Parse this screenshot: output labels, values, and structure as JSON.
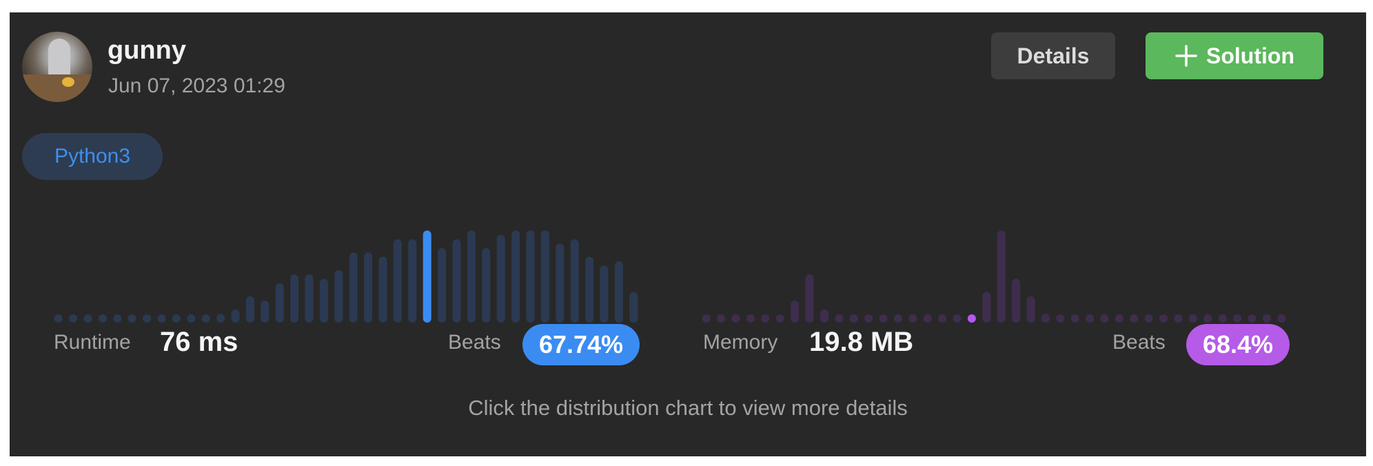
{
  "submission": {
    "username": "gunny",
    "timestamp": "Jun 07, 2023 01:29",
    "language": "Python3"
  },
  "actions": {
    "details_label": "Details",
    "solution_label": "Solution"
  },
  "runtime": {
    "label": "Runtime",
    "value": "76 ms",
    "beats_label": "Beats",
    "beats_value": "67.74%"
  },
  "memory": {
    "label": "Memory",
    "value": "19.8 MB",
    "beats_label": "Beats",
    "beats_value": "68.4%"
  },
  "hint": "Click the distribution chart to view more details",
  "colors": {
    "background": "#282828",
    "runtime_bar": "#2b3a52",
    "runtime_highlight": "#3a8cf2",
    "memory_bar": "#3f2d4e",
    "memory_highlight": "#b658f0",
    "runtime_pill": "#3a8cf2",
    "memory_pill": "#b65ae8",
    "solution_button": "#5cb85c",
    "details_button": "#3d3d3d"
  },
  "chart_data": [
    {
      "type": "bar",
      "name": "runtime-distribution",
      "values": [
        0.5,
        0.5,
        0.5,
        0.5,
        0.5,
        0.5,
        0.5,
        0.5,
        0.5,
        0.5,
        0.5,
        1,
        1.5,
        3,
        2.5,
        4.5,
        5.5,
        5.5,
        5,
        6,
        8,
        8,
        7.5,
        9.5,
        9.5,
        10.5,
        8.5,
        9.5,
        10.5,
        8.5,
        10,
        10.5,
        10.5,
        10.5,
        9,
        9.5,
        7.5,
        6.5,
        7,
        3.5
      ],
      "highlight_index": 25,
      "ylim": [
        0,
        11
      ]
    },
    {
      "type": "bar",
      "name": "memory-distribution",
      "values": [
        0.5,
        0.5,
        0.5,
        0.5,
        0.5,
        0.5,
        2.5,
        5.5,
        1.5,
        0.5,
        0.5,
        0.5,
        0.5,
        0.5,
        0.5,
        0.5,
        0.5,
        0.5,
        0.5,
        3.5,
        10.5,
        5,
        3,
        1,
        0.5,
        0.5,
        0.5,
        0.5,
        0.5,
        0.5,
        0.5,
        0.5,
        0.5,
        0.5,
        0.5,
        0.5,
        0.5,
        0.5,
        0.5,
        0.5
      ],
      "highlight_index": 18,
      "ylim": [
        0,
        11
      ]
    }
  ]
}
